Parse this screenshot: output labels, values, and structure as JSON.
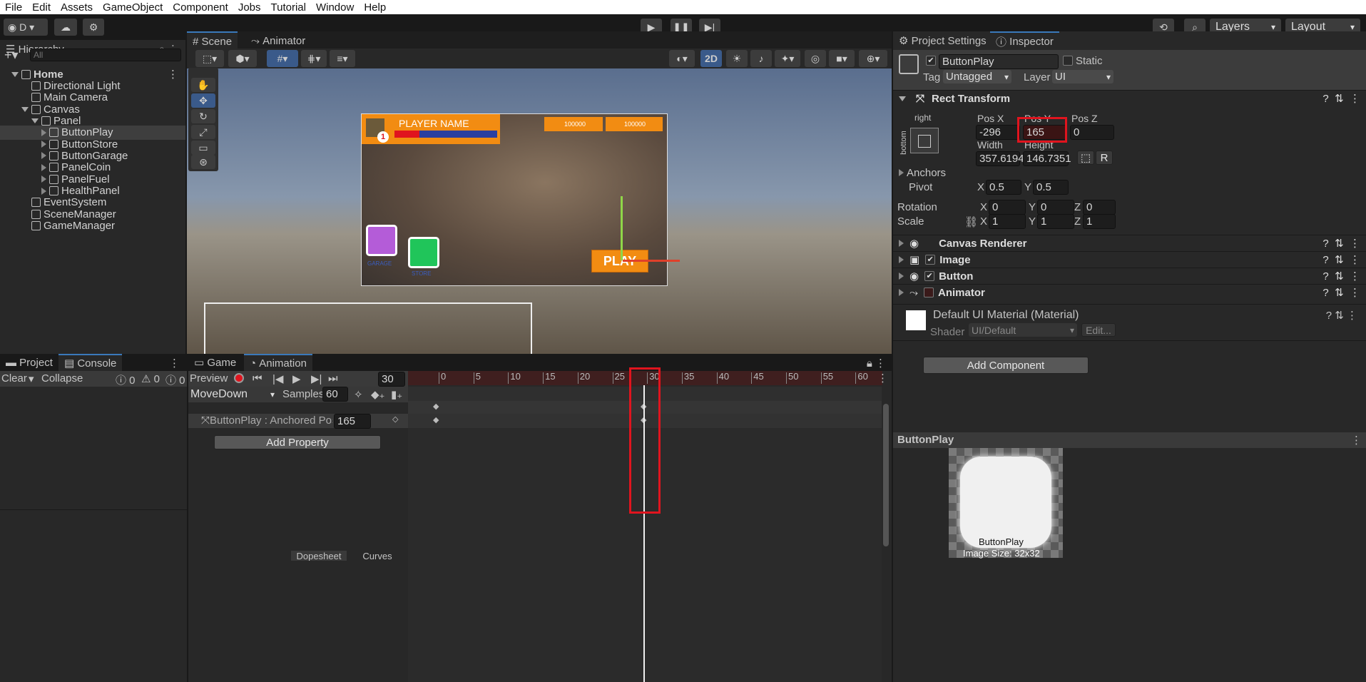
{
  "menu": [
    "File",
    "Edit",
    "Assets",
    "GameObject",
    "Component",
    "Jobs",
    "Tutorial",
    "Window",
    "Help"
  ],
  "toolbar": {
    "account": "D",
    "layers": "Layers",
    "layout": "Layout"
  },
  "hierarchy": {
    "tab": "Hierarchy",
    "search_placeholder": "All",
    "items": [
      {
        "label": "Home",
        "level": 0,
        "bold": true
      },
      {
        "label": "Directional Light",
        "level": 1
      },
      {
        "label": "Main Camera",
        "level": 1
      },
      {
        "label": "Canvas",
        "level": 1
      },
      {
        "label": "Panel",
        "level": 2
      },
      {
        "label": "ButtonPlay",
        "level": 3,
        "selected": true
      },
      {
        "label": "ButtonStore",
        "level": 3
      },
      {
        "label": "ButtonGarage",
        "level": 3
      },
      {
        "label": "PanelCoin",
        "level": 3
      },
      {
        "label": "PanelFuel",
        "level": 3
      },
      {
        "label": "HealthPanel",
        "level": 3
      },
      {
        "label": "EventSystem",
        "level": 1
      },
      {
        "label": "SceneManager",
        "level": 1
      },
      {
        "label": "GameManager",
        "level": 1
      }
    ]
  },
  "scene": {
    "tabs": [
      "Scene",
      "Animator"
    ],
    "mode_2d": "2D",
    "game_ui": {
      "player_name": "PLAYER NAME",
      "level": "1",
      "coins1": "100000",
      "coins2": "100000",
      "garage": "GARAGE",
      "store": "STORE",
      "play": "PLAY"
    }
  },
  "inspector": {
    "tabs": [
      "Project Settings",
      "Inspector"
    ],
    "object_name": "ButtonPlay",
    "static": "Static",
    "tag_label": "Tag",
    "tag": "Untagged",
    "layer_label": "Layer",
    "layer": "UI",
    "rect_transform": "Rect Transform",
    "anchor_h": "right",
    "anchor_v": "bottom",
    "posx_label": "Pos X",
    "posy_label": "Pos Y",
    "posz_label": "Pos Z",
    "posx": "-296",
    "posy": "165",
    "posz": "0",
    "width_label": "Width",
    "height_label": "Height",
    "width": "357.6194",
    "height": "146.7351",
    "r_btn": "R",
    "anchors": "Anchors",
    "pivot": "Pivot",
    "pivot_x": "0.5",
    "pivot_y": "0.5",
    "rotation": "Rotation",
    "rot_x": "0",
    "rot_y": "0",
    "rot_z": "0",
    "scale": "Scale",
    "scale_x": "1",
    "scale_y": "1",
    "scale_z": "1",
    "x": "X",
    "y": "Y",
    "z": "Z",
    "components": [
      "Canvas Renderer",
      "Image",
      "Button",
      "Animator"
    ],
    "material": "Default UI Material (Material)",
    "shader_label": "Shader",
    "shader": "UI/Default",
    "edit": "Edit...",
    "add_component": "Add Component",
    "preview_title": "ButtonPlay",
    "preview_name": "ButtonPlay",
    "image_size": "Image Size: 32x32"
  },
  "console": {
    "tabs": [
      "Project",
      "Console"
    ],
    "clear": "Clear",
    "collapse": "Collapse",
    "counts": [
      "0",
      "0",
      "0"
    ]
  },
  "animation": {
    "tabs": [
      "Game",
      "Animation"
    ],
    "preview": "Preview",
    "frame": "30",
    "clip": "MoveDown",
    "samples_label": "Samples",
    "samples": "60",
    "property": "ButtonPlay : Anchored Positic",
    "property_value": "165",
    "add_property": "Add Property",
    "ruler": [
      "0",
      "5",
      "10",
      "15",
      "20",
      "25",
      "30",
      "35",
      "40",
      "45",
      "50",
      "55",
      "60"
    ],
    "bottom_tabs": [
      "Dopesheet",
      "Curves"
    ]
  }
}
